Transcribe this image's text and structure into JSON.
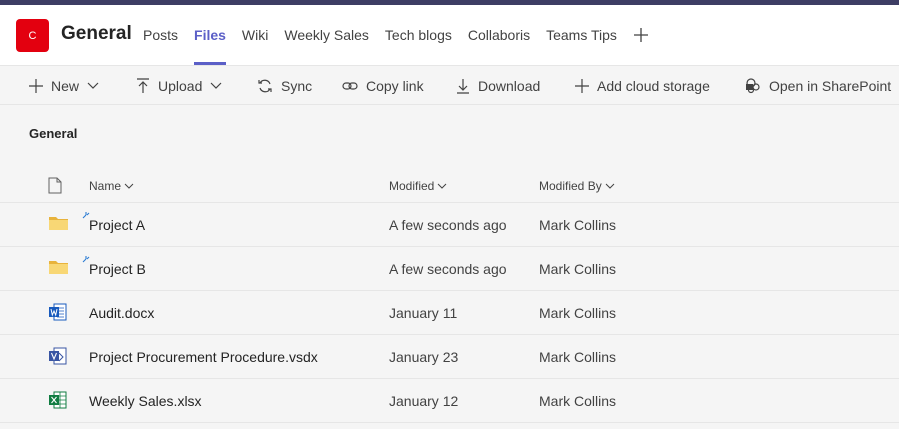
{
  "team": {
    "logo_letter": "C",
    "logo_color": "#e3000f",
    "channel": "General"
  },
  "tabs": [
    {
      "label": "Posts",
      "active": false
    },
    {
      "label": "Files",
      "active": true
    },
    {
      "label": "Wiki",
      "active": false
    },
    {
      "label": "Weekly Sales",
      "active": false
    },
    {
      "label": "Tech blogs",
      "active": false
    },
    {
      "label": "Collaboris",
      "active": false
    },
    {
      "label": "Teams Tips",
      "active": false
    }
  ],
  "toolbar": {
    "new": "New",
    "upload": "Upload",
    "sync": "Sync",
    "copy_link": "Copy link",
    "download": "Download",
    "add_cloud": "Add cloud storage",
    "open_sp": "Open in SharePoint"
  },
  "breadcrumb": "General",
  "columns": {
    "name": "Name",
    "modified": "Modified",
    "modified_by": "Modified By"
  },
  "files": [
    {
      "type": "folder",
      "name": "Project A",
      "modified": "A few seconds ago",
      "modified_by": "Mark Collins"
    },
    {
      "type": "folder",
      "name": "Project B",
      "modified": "A few seconds ago",
      "modified_by": "Mark Collins"
    },
    {
      "type": "word",
      "name": "Audit.docx",
      "modified": "January 11",
      "modified_by": "Mark Collins"
    },
    {
      "type": "visio",
      "name": "Project Procurement Procedure.vsdx",
      "modified": "January 23",
      "modified_by": "Mark Collins"
    },
    {
      "type": "excel",
      "name": "Weekly Sales.xlsx",
      "modified": "January 12",
      "modified_by": "Mark Collins"
    }
  ],
  "colors": {
    "accent": "#5b5fc7",
    "folder": "#f8d775",
    "word": "#185abd",
    "visio": "#3955a3",
    "excel": "#107c41"
  }
}
